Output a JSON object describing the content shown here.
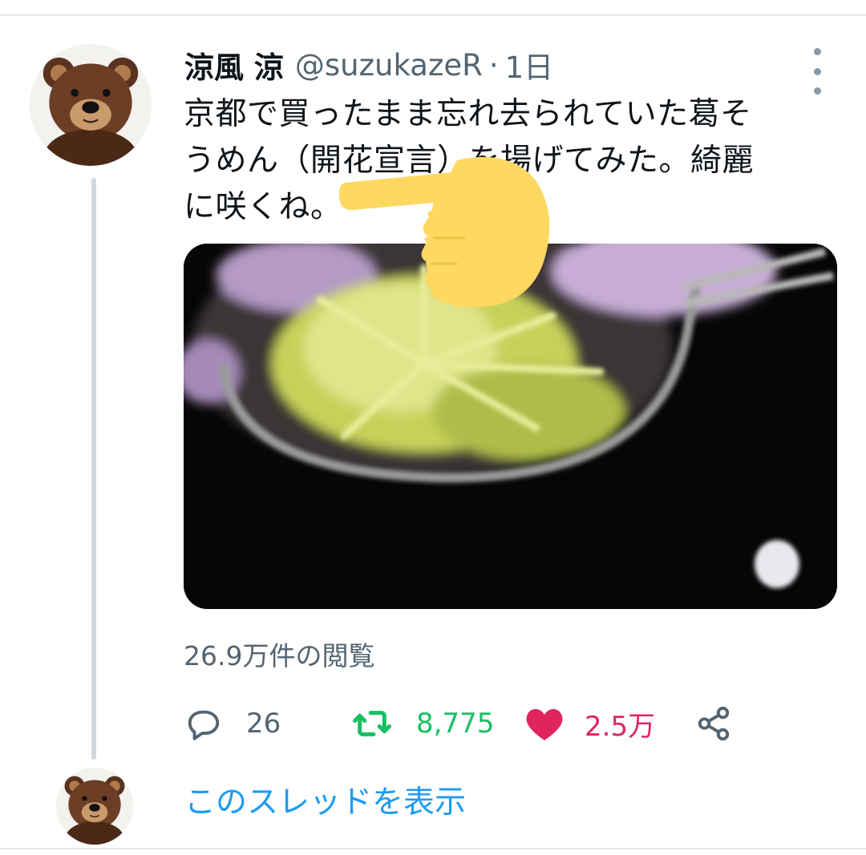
{
  "tweet": {
    "display_name": "涼風 涼",
    "handle": "@suzukazeR",
    "separator": "·",
    "time": "1日",
    "text": "京都で買ったまま忘れ去られていた葛そ\nうめん（開花宣言）を揚げてみた。綺麗\nに咲くね。",
    "views": "26.9万件の閲覧"
  },
  "actions": {
    "reply": {
      "icon": "speech-bubble-icon",
      "count": "26"
    },
    "retweet": {
      "icon": "retweet-arrows-icon",
      "count": "8,775",
      "color": "#17bf63"
    },
    "like": {
      "icon": "heart-icon",
      "count": "2.5万",
      "color": "#e0245e"
    },
    "share": {
      "icon": "share-nodes-icon"
    }
  },
  "thread": {
    "show_label": "このスレッドを表示"
  },
  "colors": {
    "link": "#1d9bf0",
    "secondary_text": "#536471",
    "divider": "#e1e8ed"
  }
}
